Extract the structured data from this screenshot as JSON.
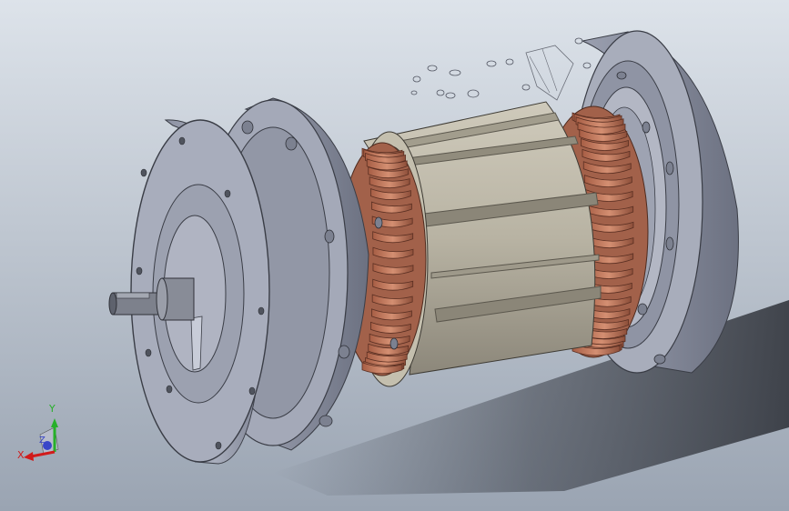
{
  "viewport": {
    "background_top": "#dde3ea",
    "background_bottom": "#9aa4b2"
  },
  "model": {
    "housing_color": "#9ea3b3",
    "housing_dark": "#6f7585",
    "housing_light": "#c4c8d6",
    "winding_color": "#c07a5e",
    "winding_dark": "#8d4f3a",
    "stator_color": "#b8b3a3",
    "stator_dark": "#8c877a",
    "shaft_color": "#7d818c"
  },
  "triad": {
    "x_label": "X",
    "y_label": "Y",
    "z_label": "Z",
    "x_color": "#d11b1b",
    "y_color": "#27b02a",
    "z_color": "#3a46c8"
  }
}
